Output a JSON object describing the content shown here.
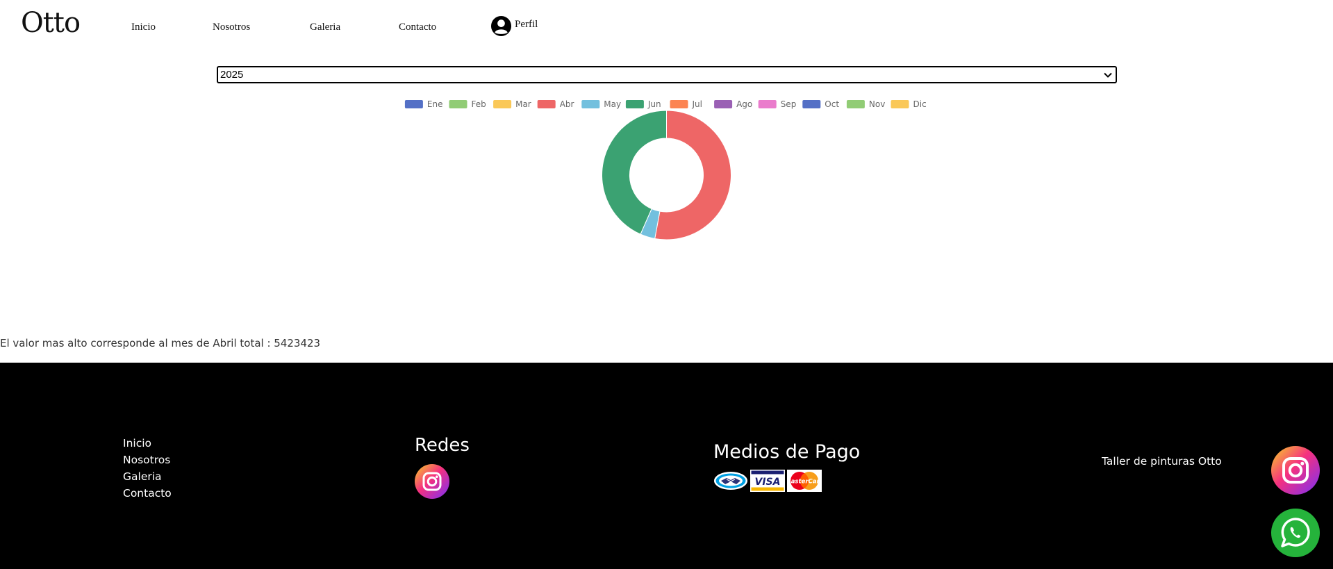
{
  "header": {
    "brand": "Otto",
    "nav": [
      {
        "label": "Inicio"
      },
      {
        "label": "Nosotros"
      },
      {
        "label": "Galeria"
      },
      {
        "label": "Contacto"
      }
    ],
    "profile_label": "Perfil",
    "profile_icon": "user-circle-icon"
  },
  "year_select": {
    "value": "2025",
    "chevron_icon": "chevron-down-icon"
  },
  "chart_data": {
    "type": "doughnut",
    "legend_position": "top",
    "categories": [
      "Ene",
      "Feb",
      "Mar",
      "Abr",
      "May",
      "Jun",
      "Jul",
      "Ago",
      "Sep",
      "Oct",
      "Nov",
      "Dic"
    ],
    "colors": [
      "#5470c6",
      "#91cc75",
      "#fac858",
      "#ee6666",
      "#73c0de",
      "#3ba272",
      "#fc8452",
      "#9a60b4",
      "#ea7ccc",
      "#5470c6",
      "#91cc75",
      "#fac858"
    ],
    "values": [
      0,
      0,
      0,
      5423423,
      380000,
      4450000,
      0,
      0,
      0,
      0,
      0,
      0
    ]
  },
  "summary": {
    "text": "El valor mas alto corresponde al mes de Abril total : 5423423"
  },
  "footer": {
    "links": [
      {
        "label": "Inicio"
      },
      {
        "label": "Nosotros"
      },
      {
        "label": "Galeria"
      },
      {
        "label": "Contacto"
      }
    ],
    "redes_title": "Redes",
    "pago_title": "Medios de Pago",
    "payment_methods": [
      "mercadopago-logo",
      "visa-logo",
      "mastercard-logo"
    ],
    "tagline": "Taller de pinturas Otto"
  },
  "floating": {
    "instagram_icon": "instagram-icon",
    "whatsapp_icon": "whatsapp-icon"
  }
}
